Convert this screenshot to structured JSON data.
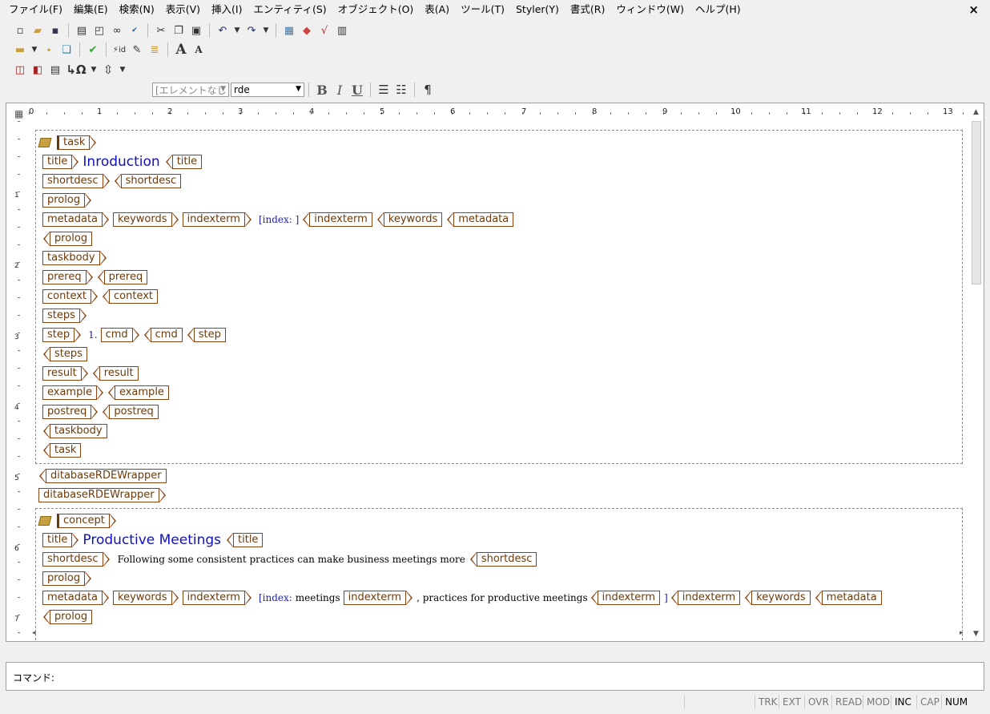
{
  "menu": [
    "ファイル(F)",
    "編集(E)",
    "検索(N)",
    "表示(V)",
    "挿入(I)",
    "エンティティ(S)",
    "オブジェクト(O)",
    "表(A)",
    "ツール(T)",
    "Styler(Y)",
    "書式(R)",
    "ウィンドウ(W)",
    "ヘルプ(H)"
  ],
  "close_label": "×",
  "toolbar": {
    "element_select": "[エレメントなし",
    "style_select": "rde",
    "bold": "B",
    "italic": "I",
    "underline": "U",
    "pilcrow": "¶",
    "text_grow": "A",
    "text_shrink": "A"
  },
  "ruler": [
    "0",
    "1",
    "2",
    "3",
    "4",
    "5",
    "6",
    "7",
    "8",
    "9",
    "10",
    "11",
    "12",
    "13"
  ],
  "vruler": [
    "1",
    "2",
    "3",
    "4",
    "5",
    "6",
    "7"
  ],
  "doc": {
    "task": {
      "root": "task",
      "title_open": "title",
      "title_text": "Inroduction",
      "title_close": "title",
      "shortdesc_open": "shortdesc",
      "shortdesc_close": "shortdesc",
      "prolog_open": "prolog",
      "metadata_open": "metadata",
      "keywords_open": "keywords",
      "indexterm_open": "indexterm",
      "index_label": "[index: ]",
      "indexterm_close": "indexterm",
      "keywords_close": "keywords",
      "metadata_close": "metadata",
      "prolog_close": "prolog",
      "taskbody_open": "taskbody",
      "prereq_open": "prereq",
      "prereq_close": "prereq",
      "context_open": "context",
      "context_close": "context",
      "steps_open": "steps",
      "step_open": "step",
      "step_number": "1.",
      "cmd_open": "cmd",
      "cmd_close": "cmd",
      "step_close": "step",
      "steps_close": "steps",
      "result_open": "result",
      "result_close": "result",
      "example_open": "example",
      "example_close": "example",
      "postreq_open": "postreq",
      "postreq_close": "postreq",
      "taskbody_close": "taskbody",
      "task_close": "task"
    },
    "wrapper_close": "ditabaseRDEWrapper",
    "wrapper_open": "ditabaseRDEWrapper",
    "concept": {
      "root": "concept",
      "title_open": "title",
      "title_text": "Productive Meetings",
      "title_close": "title",
      "shortdesc_open": "shortdesc",
      "shortdesc_text": "Following some consistent practices can make business meetings more",
      "shortdesc_close": "shortdesc",
      "prolog_open": "prolog",
      "metadata_open": "metadata",
      "keywords_open": "keywords",
      "indexterm_open": "indexterm",
      "index_label": "[index:",
      "index_term1": "meetings",
      "indexterm_inner_open": "indexterm",
      "index_term2": ", practices for productive meetings",
      "indexterm_inner_close": "indexterm",
      "index_end": "]",
      "indexterm_close": "indexterm",
      "keywords_close": "keywords",
      "metadata_close": "metadata",
      "prolog_close": "prolog"
    }
  },
  "command_label": "コマンド:",
  "status": [
    "TRK",
    "EXT",
    "OVR",
    "READ",
    "MOD",
    "INC",
    "CAP",
    "NUM"
  ]
}
